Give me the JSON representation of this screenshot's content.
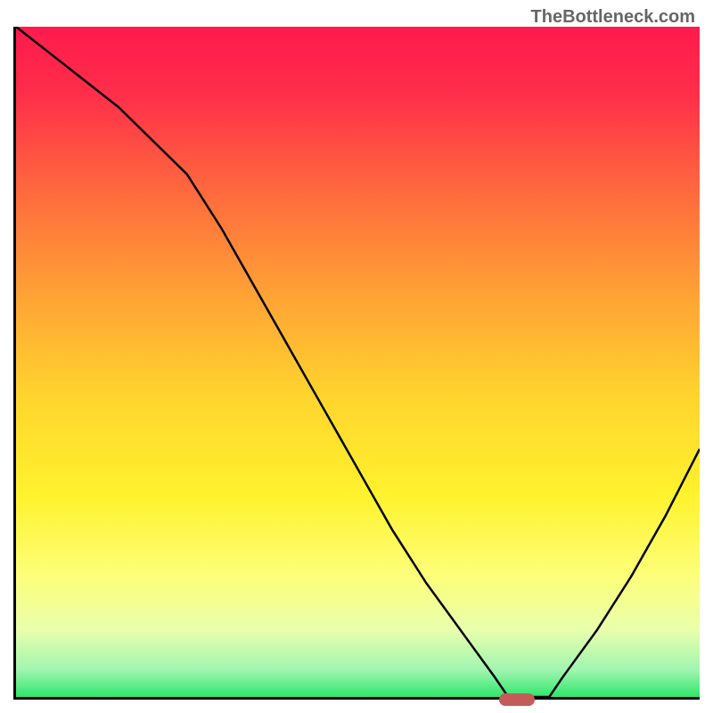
{
  "watermark": "TheBottleneck.com",
  "chart_data": {
    "type": "line",
    "title": "",
    "xlabel": "",
    "ylabel": "",
    "x": [
      0,
      5,
      10,
      15,
      20,
      25,
      30,
      35,
      40,
      45,
      50,
      55,
      60,
      65,
      70,
      72,
      75,
      78,
      80,
      85,
      90,
      95,
      100
    ],
    "values": [
      100,
      96,
      92,
      88,
      83,
      78,
      70,
      61,
      52,
      43,
      34,
      25,
      17,
      10,
      3,
      0,
      0,
      0,
      3,
      10,
      18,
      27,
      37
    ],
    "ylim": [
      0,
      100
    ],
    "xlim": [
      0,
      100
    ],
    "gradient_stops": [
      {
        "pos": 0,
        "color": "#ff1a4d"
      },
      {
        "pos": 10,
        "color": "#ff2e4a"
      },
      {
        "pos": 25,
        "color": "#ff6b3d"
      },
      {
        "pos": 40,
        "color": "#ffa235"
      },
      {
        "pos": 55,
        "color": "#ffd42e"
      },
      {
        "pos": 70,
        "color": "#fff22e"
      },
      {
        "pos": 82,
        "color": "#fdff7a"
      },
      {
        "pos": 90,
        "color": "#e8ffac"
      },
      {
        "pos": 96,
        "color": "#a0f5b0"
      },
      {
        "pos": 100,
        "color": "#2ee66b"
      }
    ],
    "marker": {
      "x": 73,
      "y": 0
    }
  }
}
